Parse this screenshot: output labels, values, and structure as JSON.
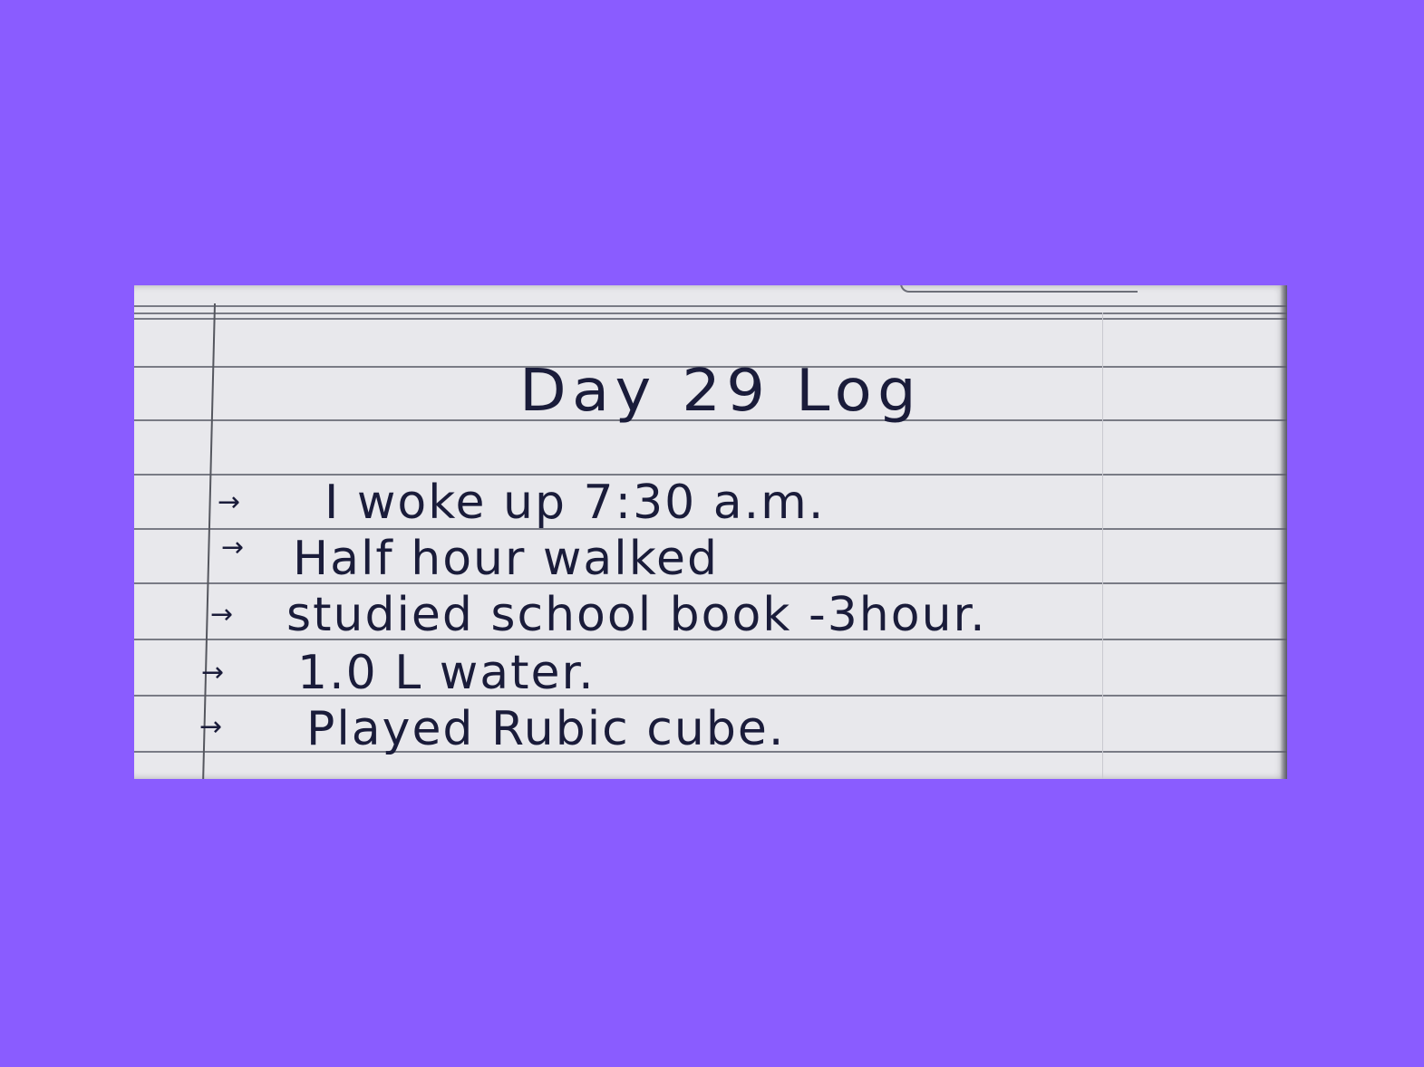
{
  "notebook": {
    "title": "Day 29 Log",
    "entries": [
      {
        "bullet": "→",
        "text": "I woke up 7:30 a.m."
      },
      {
        "bullet": "→",
        "text": "Half hour walked"
      },
      {
        "bullet": "→",
        "text": "studied school book -3hour."
      },
      {
        "bullet": "→",
        "text": "1.0 L water."
      },
      {
        "bullet": "→",
        "text": "Played Rubic cube."
      }
    ]
  },
  "colors": {
    "background": "#8a5cff",
    "paper": "#e8e8ec",
    "ink": "#1a1c3a",
    "rule": "#5c5f6b"
  }
}
